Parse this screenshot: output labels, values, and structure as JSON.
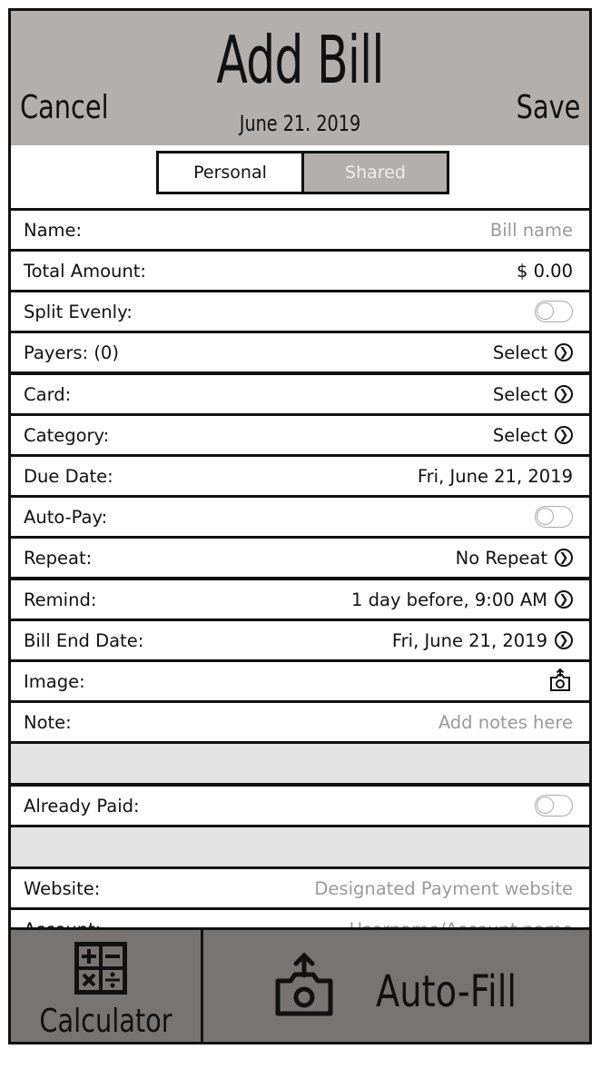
{
  "header": {
    "title": "Add Bill",
    "date": "June 21. 2019",
    "cancel_label": "Cancel",
    "save_label": "Save"
  },
  "segment": {
    "personal_label": "Personal",
    "shared_label": "Shared",
    "selected": "Shared"
  },
  "rows": {
    "name": {
      "label": "Name:",
      "placeholder": "Bill name"
    },
    "total": {
      "label": "Total Amount:",
      "value": "$ 0.00"
    },
    "split": {
      "label": "Split Evenly:"
    },
    "payers": {
      "label": "Payers: (0)",
      "value": "Select"
    },
    "card": {
      "label": "Card:",
      "value": "Select"
    },
    "category": {
      "label": "Category:",
      "value": "Select"
    },
    "due_date": {
      "label": "Due Date:",
      "value": "Fri, June 21, 2019"
    },
    "auto_pay": {
      "label": "Auto-Pay:"
    },
    "repeat": {
      "label": "Repeat:",
      "value": "No Repeat"
    },
    "remind": {
      "label": "Remind:",
      "value": "1 day before, 9:00 AM"
    },
    "bill_end_date": {
      "label": "Bill End Date:",
      "value": "Fri, June 21, 2019"
    },
    "image": {
      "label": "Image:"
    },
    "note": {
      "label": "Note:",
      "placeholder": "Add notes here"
    },
    "already_paid": {
      "label": "Already Paid:"
    },
    "website": {
      "label": "Website:",
      "placeholder": "Designated Payment website"
    },
    "account": {
      "label": "Account:",
      "placeholder": "Username/Account name"
    }
  },
  "bottom": {
    "calculator_label": "Calculator",
    "autofill_label": "Auto-Fill"
  },
  "icons": {
    "chevron": "chevron-right-circle-icon",
    "camera": "camera-upload-icon",
    "calculator": "calculator-icon"
  },
  "colors": {
    "header_bg": "#b2afad",
    "bottom_bg": "#787472",
    "band_bg": "#e3e3e3",
    "placeholder": "#9a9a9a"
  }
}
